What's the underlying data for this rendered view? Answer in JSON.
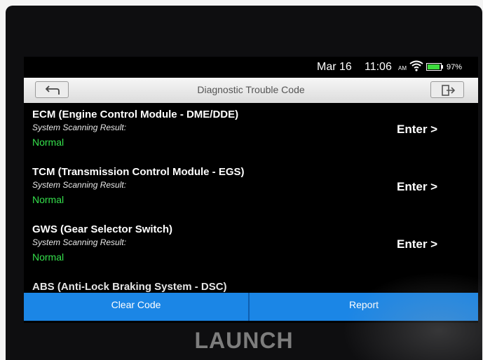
{
  "status_bar": {
    "date": "Mar 16",
    "time": "11:06",
    "ampm": "AM",
    "wifi_icon": "wifi-icon",
    "battery_percent": "97%"
  },
  "header": {
    "title": "Diagnostic Trouble Code",
    "back_icon": "back-arrow-icon",
    "exit_icon": "exit-icon"
  },
  "modules": [
    {
      "name": "ECM (Engine Control Module - DME/DDE)",
      "subtitle": "System Scanning Result:",
      "status": "Normal",
      "action": "Enter >"
    },
    {
      "name": "TCM (Transmission Control Module - EGS)",
      "subtitle": "System Scanning Result:",
      "status": "Normal",
      "action": "Enter >"
    },
    {
      "name": "GWS (Gear Selector Switch)",
      "subtitle": "System Scanning Result:",
      "status": "Normal",
      "action": "Enter >"
    },
    {
      "name": "ABS (Anti-Lock Braking System - DSC)"
    }
  ],
  "actions": {
    "clear_code": "Clear Code",
    "report": "Report"
  },
  "device": {
    "brand": "LAUNCH"
  },
  "colors": {
    "accent": "#1b86e6",
    "status_normal": "#35e04c",
    "battery": "#3ddc3d"
  }
}
